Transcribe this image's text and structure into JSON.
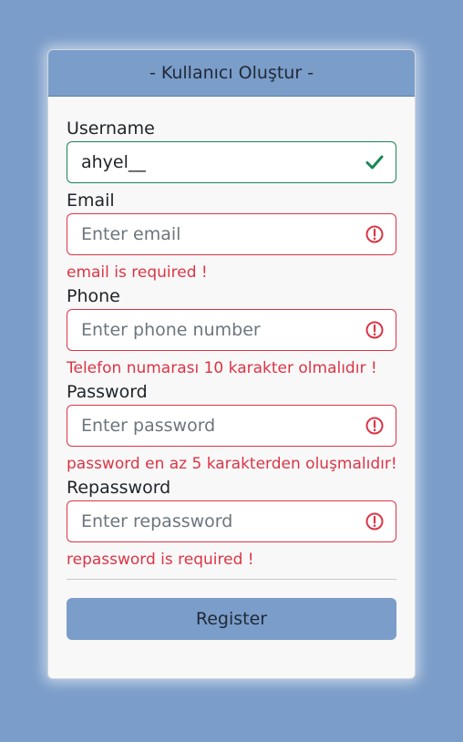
{
  "card": {
    "title": "- Kullanıcı Oluştur -"
  },
  "fields": {
    "username": {
      "label": "Username",
      "value": "ahyel__",
      "state": "valid"
    },
    "email": {
      "label": "Email",
      "placeholder": "Enter email",
      "error": "email is required !",
      "state": "invalid"
    },
    "phone": {
      "label": "Phone",
      "placeholder": "Enter phone number",
      "error": "Telefon numarası 10 karakter olmalıdır !",
      "state": "invalid"
    },
    "password": {
      "label": "Password",
      "placeholder": "Enter password",
      "error": "password en az 5 karakterden oluşmalıdır!",
      "state": "invalid"
    },
    "repassword": {
      "label": "Repassword",
      "placeholder": "Enter repassword",
      "error": "repassword is required !",
      "state": "invalid"
    }
  },
  "actions": {
    "register_label": "Register"
  },
  "icons": {
    "valid": "check-icon",
    "invalid": "exclamation-circle-icon"
  },
  "colors": {
    "background": "#7b9dc9",
    "card": "#f8f8f8",
    "valid": "#198754",
    "invalid": "#dc3545",
    "button": "#7b9dc9"
  }
}
